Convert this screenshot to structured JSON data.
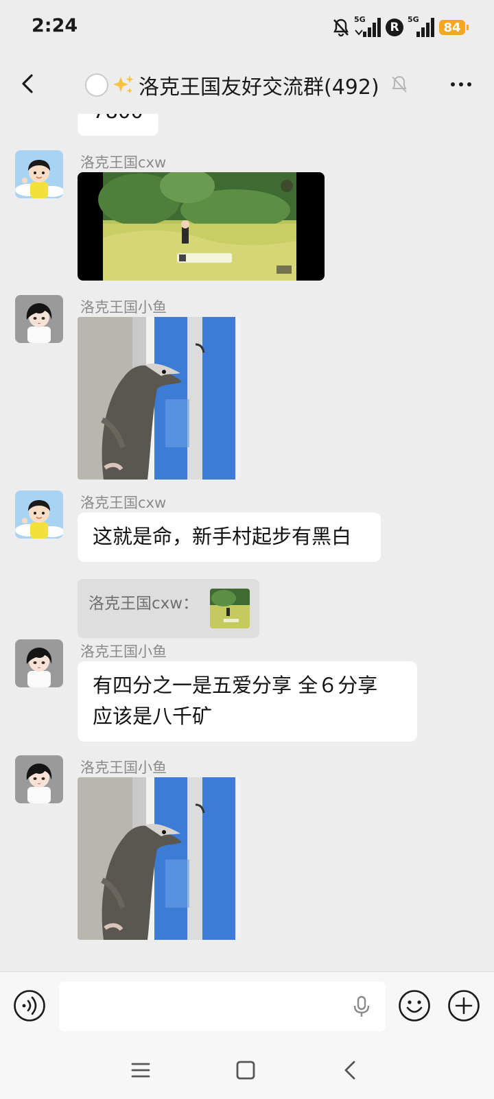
{
  "status_bar": {
    "time": "2:24",
    "battery": "84",
    "signal_label_1": "5G",
    "signal_label_2": "5G",
    "r_badge": "R"
  },
  "header": {
    "title": "洛克王国友好交流群(492)",
    "title_emoji": "sparkles-icon"
  },
  "messages": {
    "partial_top": {
      "text": "7800"
    },
    "m1": {
      "sender": "洛克王国cxw",
      "type": "video-screenshot"
    },
    "m2": {
      "sender": "洛克王国小鱼",
      "type": "image"
    },
    "m3": {
      "sender": "洛克王国cxw",
      "text": "这就是命，新手村起步有黑白",
      "quote_text": "洛克王国cxw："
    },
    "m4": {
      "sender": "洛克王国小鱼",
      "line1": "有四分之一是五爱分享 全６分享",
      "line2": "应该是八千矿"
    },
    "m5": {
      "sender": "洛克王国小鱼",
      "type": "image"
    }
  },
  "colors": {
    "background": "#ededed",
    "bubble": "#ffffff",
    "battery": "#f5a623",
    "sender_text": "#8a8a8a"
  }
}
